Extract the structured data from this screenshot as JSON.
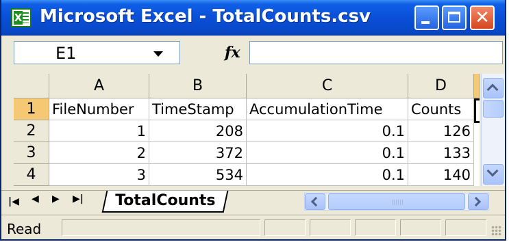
{
  "window": {
    "title": "Microsoft Excel - TotalCounts.csv",
    "app_icon": "excel-icon",
    "controls": [
      "minimize-icon",
      "maximize-icon",
      "close-icon"
    ],
    "close_glyph": "✕"
  },
  "formula_bar": {
    "name_box": "E1",
    "fx_label": "fx",
    "formula": ""
  },
  "grid": {
    "columns": [
      "A",
      "B",
      "C",
      "D"
    ],
    "row_numbers": [
      "1",
      "2",
      "3",
      "4"
    ],
    "rows": [
      [
        "FileNumber",
        "TimeStamp",
        "AccumulationTime",
        "Counts"
      ],
      [
        "1",
        "208",
        "0.1",
        "126"
      ],
      [
        "2",
        "372",
        "0.1",
        "133"
      ],
      [
        "3",
        "534",
        "0.1",
        "140"
      ]
    ],
    "selected_cell": "E1"
  },
  "sheet_tabs": {
    "nav": [
      "◀◀",
      "◀",
      "▶",
      "▶▶"
    ],
    "active": "TotalCounts"
  },
  "status_bar": {
    "text": "Read"
  },
  "colors": {
    "title_bar": "#0a4fd6",
    "selected_header": "#f5c873",
    "chrome": "#ece9d8"
  }
}
